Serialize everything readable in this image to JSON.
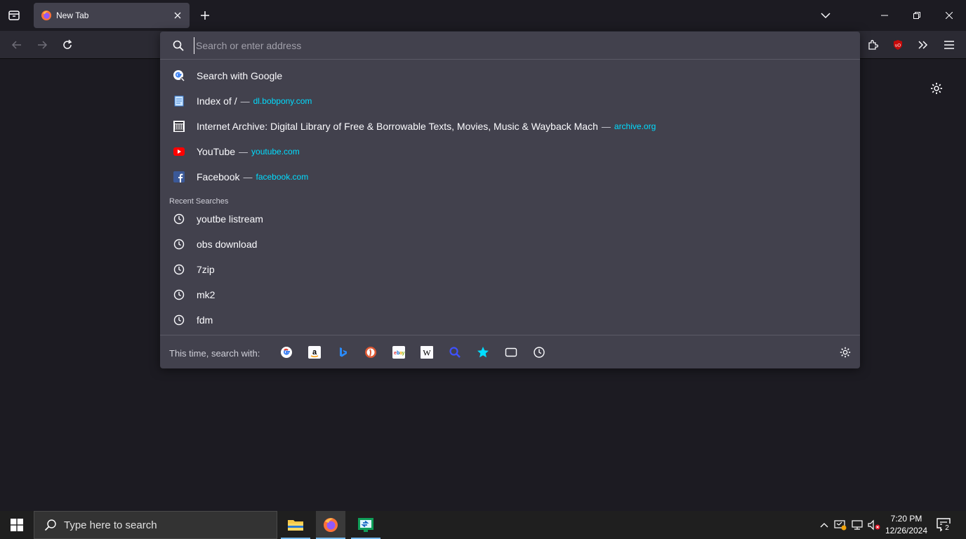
{
  "tab": {
    "title": "New Tab"
  },
  "urlbar": {
    "placeholder": "Search or enter address",
    "results": [
      {
        "title": "Search with Google",
        "sep": "",
        "url": "",
        "icon": "google-search-icon"
      },
      {
        "title": "Index of /",
        "sep": "—",
        "url": "dl.bobpony.com",
        "icon": "page-icon"
      },
      {
        "title": "Internet Archive: Digital Library of Free & Borrowable Texts, Movies, Music & Wayback Mach",
        "sep": "—",
        "url": "archive.org",
        "icon": "archive-icon"
      },
      {
        "title": "YouTube",
        "sep": "—",
        "url": "youtube.com",
        "icon": "youtube-icon"
      },
      {
        "title": "Facebook",
        "sep": "—",
        "url": "facebook.com",
        "icon": "facebook-icon"
      }
    ],
    "recent_label": "Recent Searches",
    "recent": [
      "youtbe listream",
      "obs download",
      "7zip",
      "mk2",
      "fdm"
    ],
    "oneoff_label": "This time, search with:",
    "oneoffs": [
      "google-icon",
      "amazon-icon",
      "bing-icon",
      "duckduckgo-icon",
      "ebay-icon",
      "wikipedia-icon",
      "search-engine-icon",
      "bookmarks-icon",
      "tabs-icon",
      "history-icon"
    ]
  },
  "taskbar": {
    "search_placeholder": "Type here to search",
    "time": "7:20 PM",
    "date": "12/26/2024",
    "notification_count": "2"
  },
  "colors": {
    "accent": "#00ddff",
    "panel": "#42414d",
    "background": "#1c1b22"
  }
}
